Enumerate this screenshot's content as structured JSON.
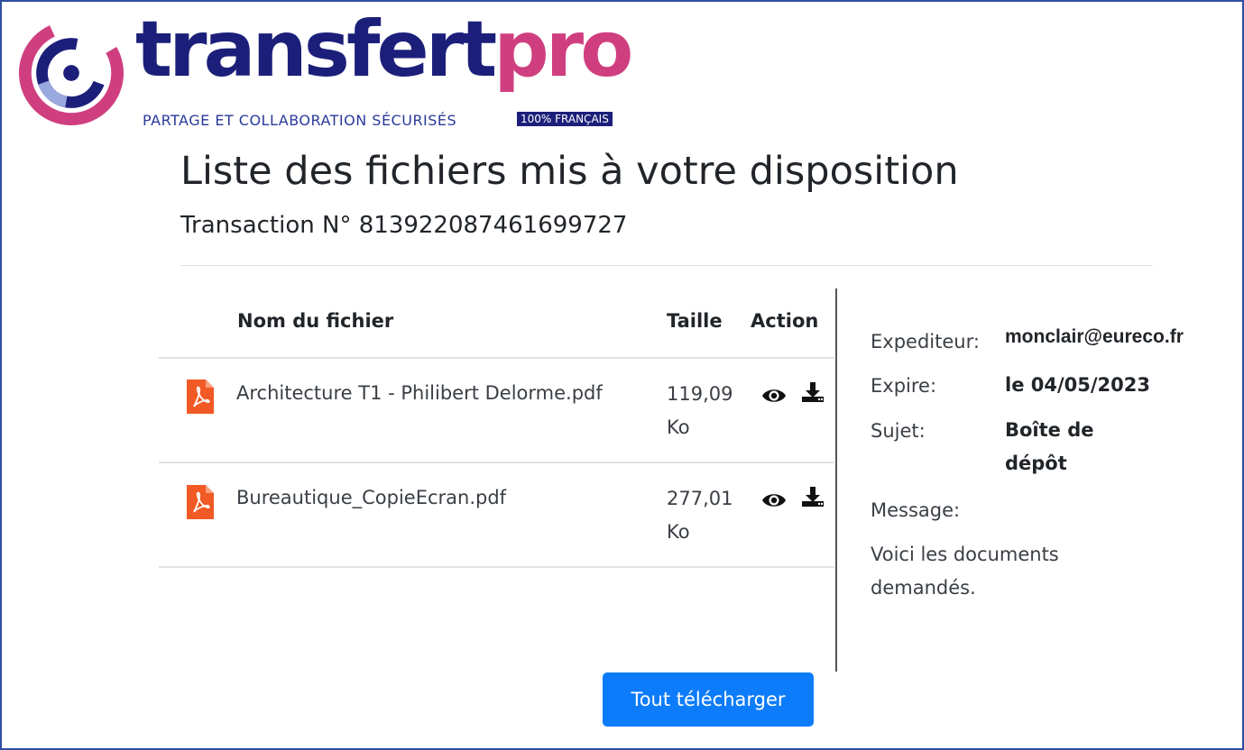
{
  "brand": {
    "word_part1": "transfert",
    "word_part2": "pro",
    "tagline": "PARTAGE ET COLLABORATION SÉCURISÉS",
    "badge": "100% FRANÇAIS",
    "colors": {
      "navy": "#1c1f7a",
      "pink": "#cf3f7f"
    }
  },
  "header": {
    "title": "Liste des fichiers mis à votre disposition",
    "transaction": "Transaction N° 813922087461699727"
  },
  "table": {
    "columns": {
      "name": "Nom du fichier",
      "size": "Taille",
      "action": "Action"
    },
    "rows": [
      {
        "icon": "pdf-icon",
        "name": "Architecture T1 - Philibert Delorme.pdf",
        "size": "119,09 Ko",
        "actions": [
          "eye-icon",
          "download-icon"
        ]
      },
      {
        "icon": "pdf-icon",
        "name": "Bureautique_CopieEcran.pdf",
        "size": "277,01 Ko",
        "actions": [
          "eye-icon",
          "download-icon"
        ]
      }
    ]
  },
  "details": {
    "sender_label": "Expediteur:",
    "sender_value": "monclair@eureco.fr",
    "expires_label": "Expire:",
    "expires_value": "le 04/05/2023",
    "subject_label": "Sujet:",
    "subject_value": "Boîte de dépôt",
    "message_label": "Message:",
    "message_value": "Voici les documents demandés."
  },
  "actions": {
    "download_all": "Tout télécharger",
    "accent": "#0d7cfa"
  }
}
